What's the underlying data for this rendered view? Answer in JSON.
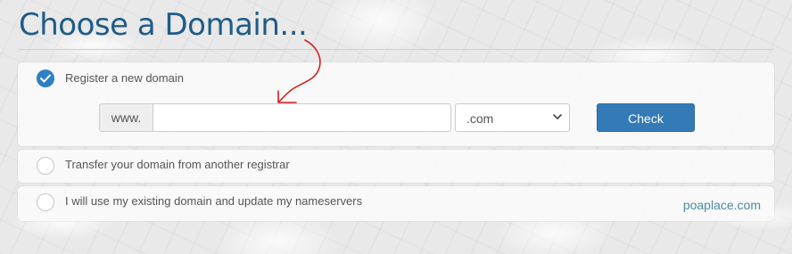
{
  "page": {
    "title": "Choose a Domain..."
  },
  "options": {
    "register": {
      "label": "Register a new domain",
      "selected": true,
      "www_prefix": "www.",
      "domain_input_value": "",
      "tld_selected": ".com",
      "check_button_label": "Check"
    },
    "transfer": {
      "label": "Transfer your domain from another registrar",
      "selected": false
    },
    "existing": {
      "label": "I will use my existing domain and update my nameservers",
      "selected": false
    }
  },
  "watermark": "poaplace.com",
  "colors": {
    "title": "#1f5c87",
    "accent": "#337ab7",
    "radio_checked": "#2f7fc4",
    "annotation": "#d42020"
  },
  "icons": {
    "radio_checked": "checkmark-icon",
    "select_chevron": "chevron-down-icon",
    "annotation": "hand-drawn-arrow-icon"
  }
}
